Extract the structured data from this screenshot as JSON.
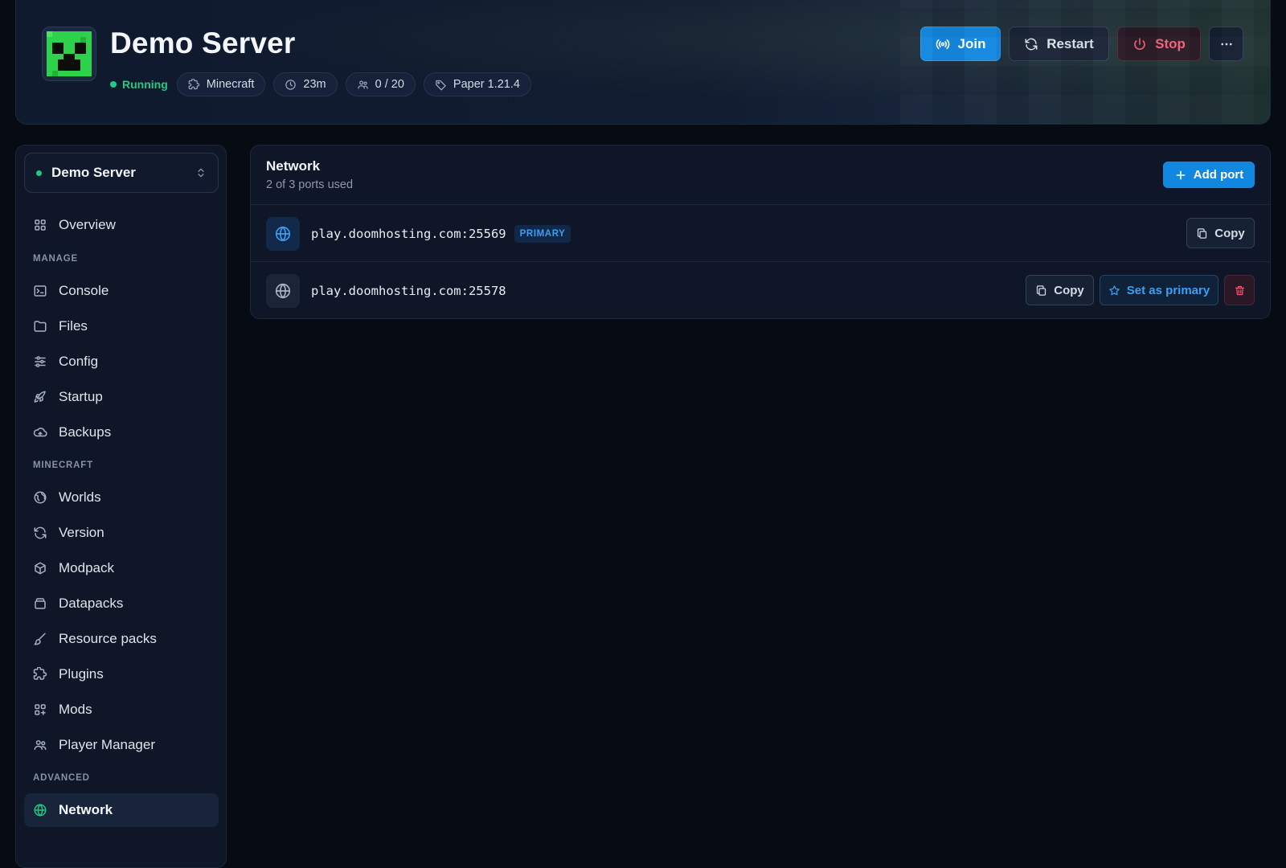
{
  "header": {
    "server_name": "Demo Server",
    "status": "Running",
    "chips": [
      {
        "icon": "puzzle-icon",
        "label": "Minecraft"
      },
      {
        "icon": "clock-icon",
        "label": "23m"
      },
      {
        "icon": "players-icon",
        "label": "0 / 20"
      },
      {
        "icon": "tag-icon",
        "label": "Paper 1.21.4"
      }
    ],
    "buttons": {
      "join": "Join",
      "restart": "Restart",
      "stop": "Stop",
      "more": "more-icon"
    }
  },
  "sidebar": {
    "server_selector": "Demo Server",
    "overview": "Overview",
    "sections": {
      "manage": "MANAGE",
      "minecraft": "MINECRAFT",
      "advanced": "ADVANCED"
    },
    "manage_items": [
      "Console",
      "Files",
      "Config",
      "Startup",
      "Backups"
    ],
    "minecraft_items": [
      "Worlds",
      "Version",
      "Modpack",
      "Datapacks",
      "Resource packs",
      "Plugins",
      "Mods",
      "Player Manager"
    ],
    "advanced_items": [
      "Network"
    ],
    "active_item": "Network"
  },
  "network": {
    "title": "Network",
    "subtitle": "2 of 3 ports used",
    "add_port_label": "Add port",
    "ports": [
      {
        "address": "play.doomhosting.com:25569",
        "primary": true,
        "badge": "PRIMARY",
        "copy_label": "Copy"
      },
      {
        "address": "play.doomhosting.com:25578",
        "primary": false,
        "copy_label": "Copy",
        "set_primary_label": "Set as primary"
      }
    ]
  },
  "colors": {
    "accent": "#1287e0",
    "running": "#22c980",
    "danger": "#f0607a",
    "background": "#070b14",
    "panel": "#0e1627"
  }
}
